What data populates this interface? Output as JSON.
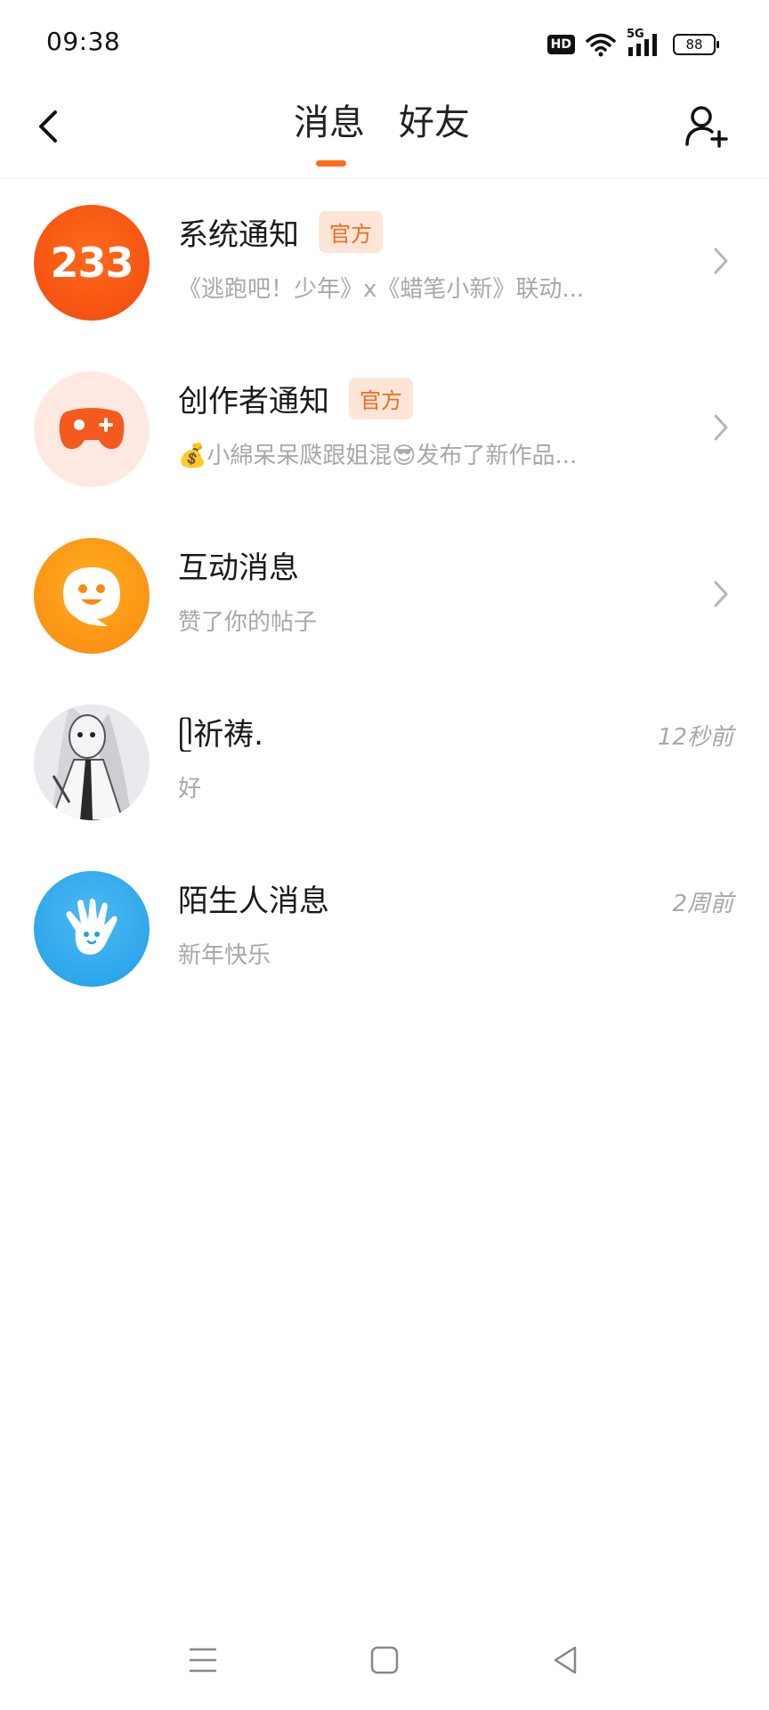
{
  "status_bar": {
    "time": "09:38",
    "hd": "HD",
    "network": "5G",
    "battery": "88",
    "icons": [
      "hd-icon",
      "wifi-icon",
      "5g-signal-icon",
      "battery-icon"
    ]
  },
  "header": {
    "tabs": [
      {
        "label": "消息",
        "active": true
      },
      {
        "label": "好友",
        "active": false
      }
    ],
    "accent_color": "#ff6b1a",
    "icons": {
      "back": "back-arrow-icon",
      "add_friend": "add-friend-icon"
    }
  },
  "messages": [
    {
      "title": "系统通知",
      "badge": "官方",
      "subtitle": "《逃跑吧！少年》x《蜡笔小新》联动...",
      "avatar_text": "233",
      "avatar_icon": "system-233-icon",
      "trailing": "chevron"
    },
    {
      "title": "创作者通知",
      "badge": "官方",
      "subtitle": "💰小綿呆呆瓞跟姐混😎发布了新作品...",
      "avatar_icon": "gamepad-icon",
      "trailing": "chevron"
    },
    {
      "title": "互动消息",
      "subtitle": "赞了你的帖子",
      "avatar_icon": "chat-smile-icon",
      "trailing": "chevron"
    },
    {
      "title": "ᥫ祈祷.",
      "subtitle": "好",
      "time": "12秒前",
      "avatar_icon": "user-photo-avatar"
    },
    {
      "title": "陌生人消息",
      "subtitle": "新年快乐",
      "time": "2周前",
      "avatar_icon": "wave-hand-icon"
    }
  ],
  "nav_bar": {
    "icons": [
      "menu-icon",
      "home-square-icon",
      "back-triangle-icon"
    ]
  }
}
